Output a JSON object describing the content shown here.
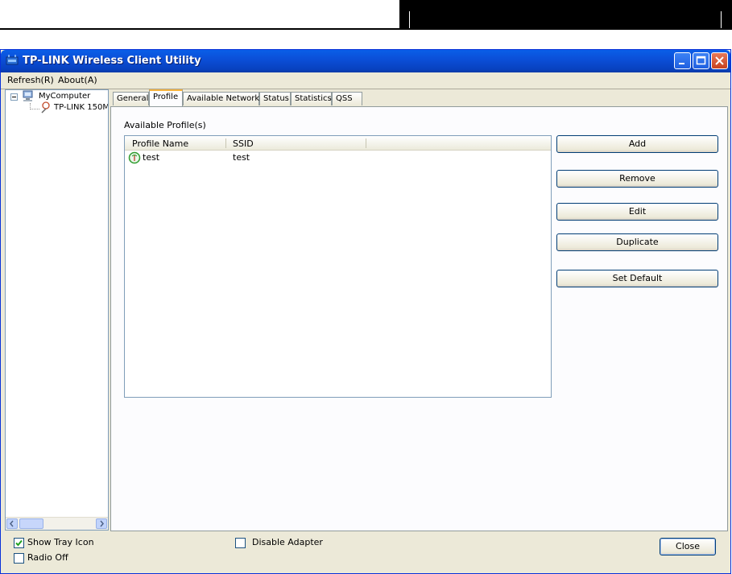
{
  "window": {
    "title": "TP-LINK Wireless Client Utility",
    "title_color": "#0a54e3"
  },
  "menu": [
    {
      "label": "Refresh(R)"
    },
    {
      "label": "About(A)"
    }
  ],
  "tree": {
    "root": "MyComputer",
    "child": "TP-LINK 150M"
  },
  "tabs": [
    {
      "label": "General"
    },
    {
      "label": "Profile",
      "active": true
    },
    {
      "label": "Available Network"
    },
    {
      "label": "Status"
    },
    {
      "label": "Statistics"
    },
    {
      "label": "QSS"
    }
  ],
  "profile": {
    "section_label": "Available Profile(s)",
    "columns": [
      "Profile Name",
      "SSID"
    ],
    "rows": [
      {
        "name": "test",
        "ssid": "test",
        "icon": "profile-active-icon"
      }
    ]
  },
  "buttons": {
    "add": "Add",
    "remove": "Remove",
    "edit": "Edit",
    "duplicate": "Duplicate",
    "set_default": "Set Default",
    "close": "Close"
  },
  "options": {
    "show_tray_icon": {
      "label": "Show Tray Icon",
      "checked": true
    },
    "radio_off": {
      "label": "Radio Off",
      "checked": false
    },
    "disable_adapter": {
      "label": "Disable Adapter",
      "checked": false
    }
  }
}
